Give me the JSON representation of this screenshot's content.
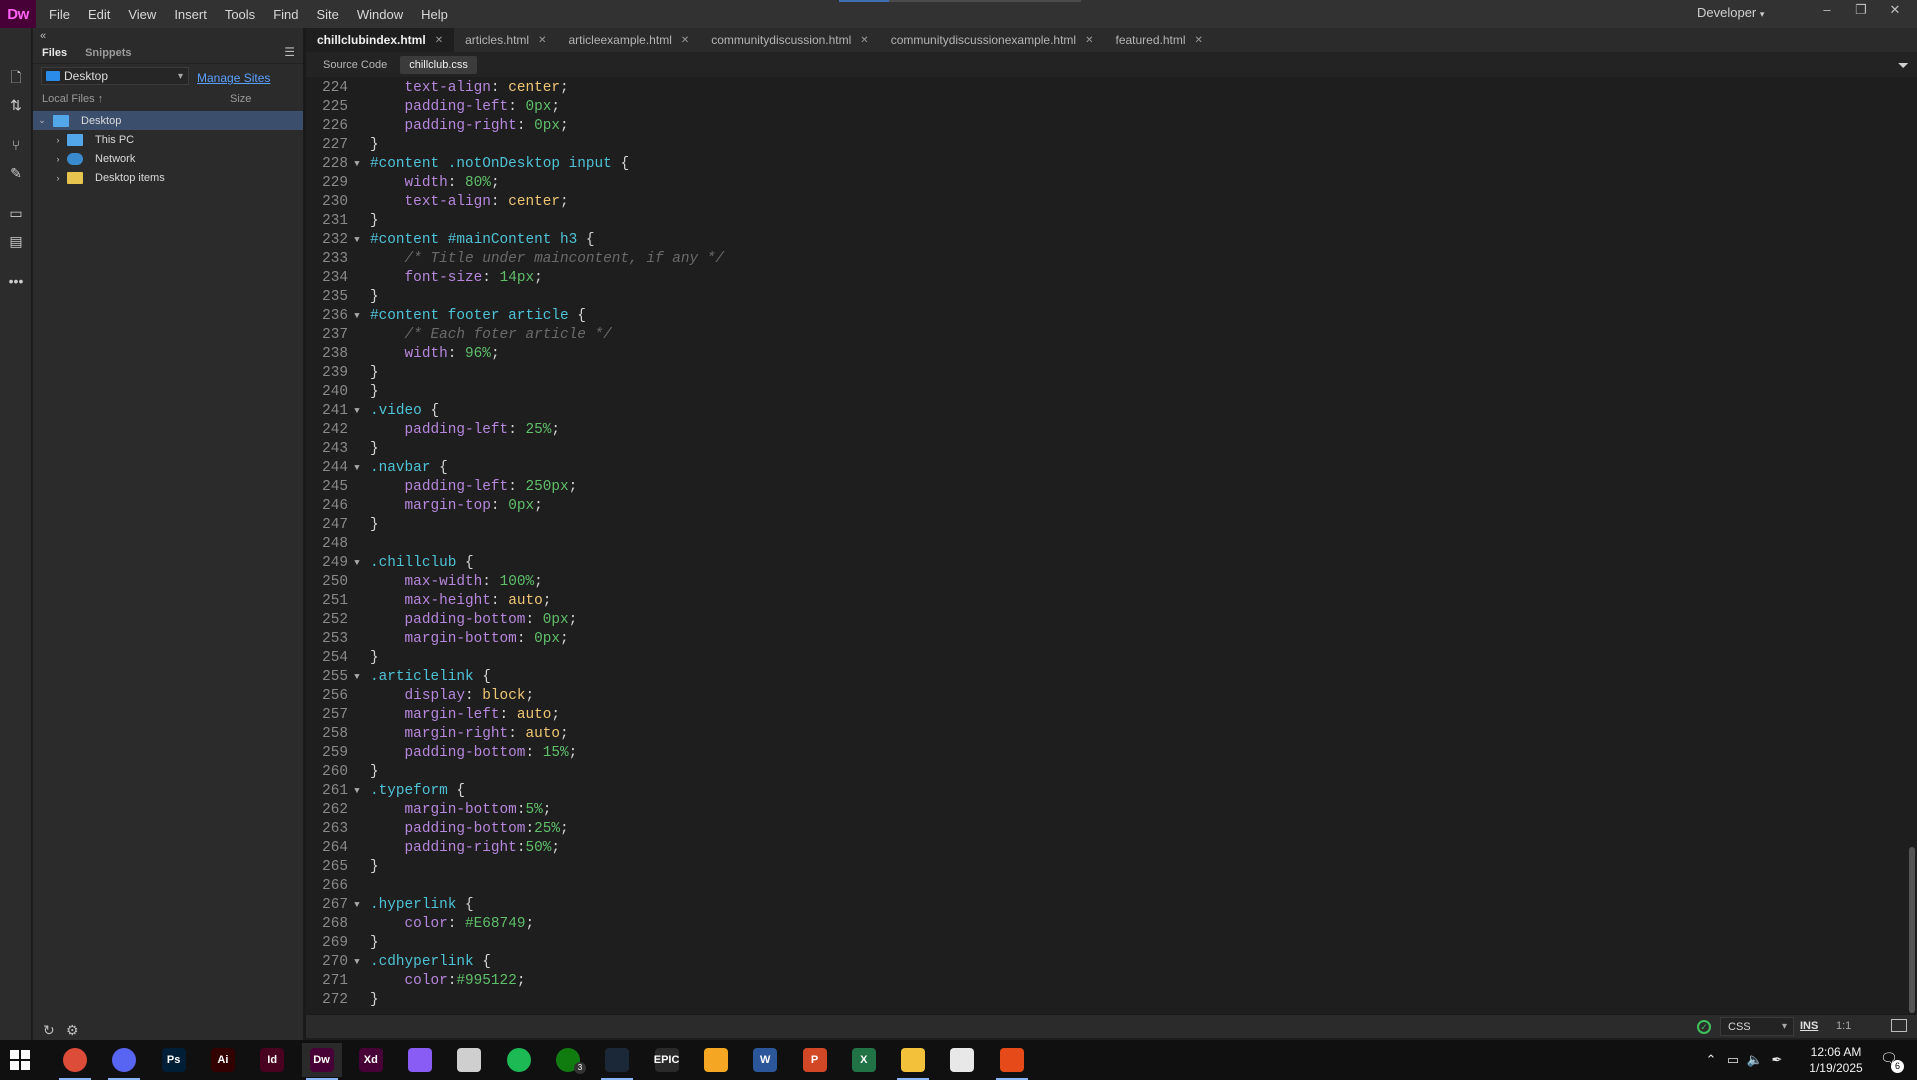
{
  "app": {
    "logo": "Dw",
    "menu": [
      "File",
      "Edit",
      "View",
      "Insert",
      "Tools",
      "Find",
      "Site",
      "Window",
      "Help"
    ],
    "workspace": "Developer",
    "accent": "#470137"
  },
  "files_panel": {
    "tabs": [
      "Files",
      "Snippets"
    ],
    "site": "Desktop",
    "manage_sites": "Manage Sites",
    "col_local": "Local Files",
    "col_size": "Size",
    "tree": [
      "Desktop",
      "This PC",
      "Network",
      "Desktop items"
    ]
  },
  "doc_tabs": [
    "chillclubindex.html",
    "articles.html",
    "articleexample.html",
    "communitydiscussion.html",
    "communitydiscussionexample.html",
    "featured.html"
  ],
  "related": [
    "Source Code",
    "chillclub.css"
  ],
  "code": [
    {
      "n": "224",
      "t": "    text-align: center;"
    },
    {
      "n": "225",
      "t": "    padding-left: 0px;"
    },
    {
      "n": "226",
      "t": "    padding-right: 0px;"
    },
    {
      "n": "227",
      "t": "}"
    },
    {
      "n": "228",
      "t": "#content .notOnDesktop input {",
      "fold": true
    },
    {
      "n": "229",
      "t": "    width: 80%;"
    },
    {
      "n": "230",
      "t": "    text-align: center;"
    },
    {
      "n": "231",
      "t": "}"
    },
    {
      "n": "232",
      "t": "#content #mainContent h3 {",
      "fold": true
    },
    {
      "n": "233",
      "t": "    /* Title under maincontent, if any */"
    },
    {
      "n": "234",
      "t": "    font-size: 14px;"
    },
    {
      "n": "235",
      "t": "}"
    },
    {
      "n": "236",
      "t": "#content footer article {",
      "fold": true
    },
    {
      "n": "237",
      "t": "    /* Each foter article */"
    },
    {
      "n": "238",
      "t": "    width: 96%;"
    },
    {
      "n": "239",
      "t": "}"
    },
    {
      "n": "240",
      "t": "}"
    },
    {
      "n": "241",
      "t": ".video {",
      "fold": true
    },
    {
      "n": "242",
      "t": "    padding-left: 25%;"
    },
    {
      "n": "243",
      "t": "}"
    },
    {
      "n": "244",
      "t": ".navbar {",
      "fold": true
    },
    {
      "n": "245",
      "t": "    padding-left: 250px;"
    },
    {
      "n": "246",
      "t": "    margin-top: 0px;"
    },
    {
      "n": "247",
      "t": "}"
    },
    {
      "n": "248",
      "t": ""
    },
    {
      "n": "249",
      "t": ".chillclub {",
      "fold": true
    },
    {
      "n": "250",
      "t": "    max-width: 100%;"
    },
    {
      "n": "251",
      "t": "    max-height: auto;"
    },
    {
      "n": "252",
      "t": "    padding-bottom: 0px;"
    },
    {
      "n": "253",
      "t": "    margin-bottom: 0px;"
    },
    {
      "n": "254",
      "t": "}"
    },
    {
      "n": "255",
      "t": ".articlelink {",
      "fold": true
    },
    {
      "n": "256",
      "t": "    display: block;"
    },
    {
      "n": "257",
      "t": "    margin-left: auto;"
    },
    {
      "n": "258",
      "t": "    margin-right: auto;"
    },
    {
      "n": "259",
      "t": "    padding-bottom: 15%;"
    },
    {
      "n": "260",
      "t": "}"
    },
    {
      "n": "261",
      "t": ".typeform {",
      "fold": true
    },
    {
      "n": "262",
      "t": "    margin-bottom:5%;"
    },
    {
      "n": "263",
      "t": "    padding-bottom:25%;"
    },
    {
      "n": "264",
      "t": "    padding-right:50%;"
    },
    {
      "n": "265",
      "t": "}"
    },
    {
      "n": "266",
      "t": ""
    },
    {
      "n": "267",
      "t": ".hyperlink {",
      "fold": true
    },
    {
      "n": "268",
      "t": "    color: #E68749;"
    },
    {
      "n": "269",
      "t": "}"
    },
    {
      "n": "270",
      "t": ".cdhyperlink {",
      "fold": true
    },
    {
      "n": "271",
      "t": "    color:#995122;"
    },
    {
      "n": "272",
      "t": "}"
    }
  ],
  "status": {
    "language": "CSS",
    "ins": "INS",
    "position": "1:1"
  },
  "taskbar": {
    "apps": [
      {
        "name": "chrome",
        "label": "",
        "color": "#dd4b39"
      },
      {
        "name": "discord",
        "label": "",
        "color": "#5865f2"
      },
      {
        "name": "photoshop",
        "label": "Ps",
        "color": "#001e36"
      },
      {
        "name": "illustrator",
        "label": "Ai",
        "color": "#330000"
      },
      {
        "name": "indesign",
        "label": "Id",
        "color": "#49021f"
      },
      {
        "name": "dreamweaver",
        "label": "Dw",
        "color": "#470137"
      },
      {
        "name": "xd",
        "label": "Xd",
        "color": "#470137"
      },
      {
        "name": "app-7",
        "label": "",
        "color": "#8a5cf6"
      },
      {
        "name": "app-8",
        "label": "",
        "color": "#cfcfcf"
      },
      {
        "name": "spotify",
        "label": "",
        "color": "#1db954"
      },
      {
        "name": "xbox",
        "label": "",
        "color": "#107c10"
      },
      {
        "name": "steam",
        "label": "",
        "color": "#1b2838"
      },
      {
        "name": "epic",
        "label": "EPIC",
        "color": "#2a2a2a"
      },
      {
        "name": "app-14",
        "label": "",
        "color": "#f5a623"
      },
      {
        "name": "word",
        "label": "W",
        "color": "#2b579a"
      },
      {
        "name": "powerpoint",
        "label": "P",
        "color": "#d24726"
      },
      {
        "name": "excel",
        "label": "X",
        "color": "#217346"
      },
      {
        "name": "file-explorer",
        "label": "",
        "color": "#f3c13a"
      },
      {
        "name": "app-19",
        "label": "",
        "color": "#e8e8e8"
      },
      {
        "name": "app-20",
        "label": "",
        "color": "#e64a19"
      }
    ],
    "xbox_badge": "3",
    "time": "12:06 AM",
    "date": "1/19/2025",
    "notifications": "6"
  }
}
